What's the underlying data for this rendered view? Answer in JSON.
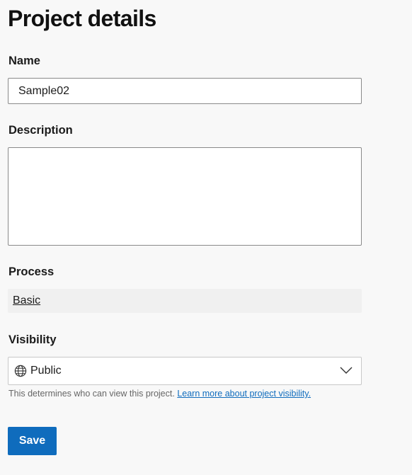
{
  "page": {
    "title": "Project details"
  },
  "name": {
    "label": "Name",
    "value": "Sample02"
  },
  "description": {
    "label": "Description",
    "value": ""
  },
  "process": {
    "label": "Process",
    "value": "Basic"
  },
  "visibility": {
    "label": "Visibility",
    "selected": "Public",
    "icon": "globe-icon",
    "dropdown_icon": "chevron-down-icon",
    "help_text": "This determines who can view this project.",
    "help_link": "Learn more about project visibility."
  },
  "actions": {
    "save_label": "Save"
  },
  "colors": {
    "accent": "#0f6cbd",
    "background": "#f8f8f8"
  }
}
